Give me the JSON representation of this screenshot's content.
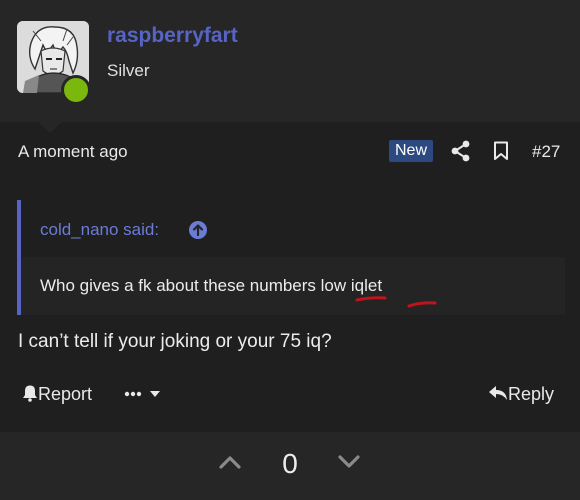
{
  "user": {
    "username": "raspberryfart",
    "rank": "Silver"
  },
  "post_meta": {
    "time": "A moment ago",
    "badge": "New",
    "post_number": "#27"
  },
  "quote": {
    "author": "cold_nano said:",
    "text": "Who gives a fk about these numbers low iqlet"
  },
  "post": {
    "body": "I can’t tell if your joking or your 75 iq?"
  },
  "actions": {
    "report_label": "Report",
    "reply_label": "Reply"
  },
  "votes": {
    "count": "0"
  },
  "colors": {
    "accent": "#5764c6",
    "online": "#7bb80d",
    "badge": "#2c4a80",
    "underline_marks": "#c0141b"
  },
  "icons": [
    "share-icon",
    "bookmark-icon",
    "arrow-up-circle-icon",
    "alert-bell-icon",
    "more-dots-icon",
    "chevron-down-icon",
    "reply-icon",
    "upvote-chevron-icon",
    "downvote-chevron-icon"
  ]
}
